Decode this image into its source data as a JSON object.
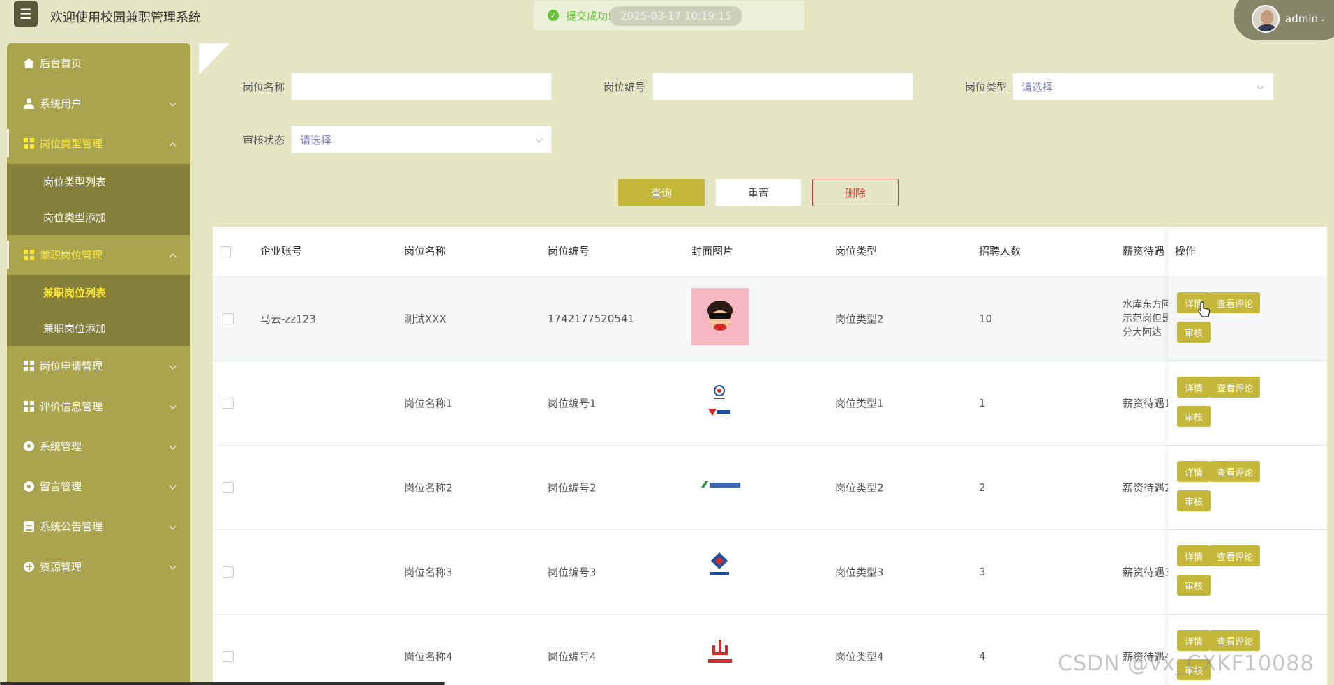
{
  "header": {
    "title": "欢迎使用校园兼职管理系统",
    "toast_text": "提交成功!",
    "toast_time": "2025-03-17 10:19:15",
    "user_name": "admin"
  },
  "sidebar": {
    "items": [
      {
        "label": "后台首页",
        "icon": "home-icon"
      },
      {
        "label": "系统用户",
        "icon": "user-icon"
      },
      {
        "label": "岗位类型管理",
        "icon": "grid-icon",
        "sub": [
          "岗位类型列表",
          "岗位类型添加"
        ]
      },
      {
        "label": "兼职岗位管理",
        "icon": "grid-icon",
        "sub": [
          "兼职岗位列表",
          "兼职岗位添加"
        ]
      },
      {
        "label": "岗位申请管理",
        "icon": "grid-icon"
      },
      {
        "label": "评价信息管理",
        "icon": "grid-icon"
      },
      {
        "label": "系统管理",
        "icon": "gear-icon"
      },
      {
        "label": "留言管理",
        "icon": "gear-icon"
      },
      {
        "label": "系统公告管理",
        "icon": "doc-icon"
      },
      {
        "label": "资源管理",
        "icon": "plus-circle-icon"
      }
    ]
  },
  "search": {
    "name_label": "岗位名称",
    "code_label": "岗位编号",
    "type_label": "岗位类型",
    "type_placeholder": "请选择",
    "status_label": "审核状态",
    "status_placeholder": "请选择",
    "query_btn": "查询",
    "reset_btn": "重置",
    "delete_btn": "删除"
  },
  "table": {
    "headers": [
      "企业账号",
      "岗位名称",
      "岗位编号",
      "封面图片",
      "岗位类型",
      "招聘人数",
      "薪资待遇",
      "操作"
    ],
    "rows": [
      {
        "account": "马云-zz123",
        "name": "测试XXX",
        "code": "1742177520541",
        "type": "岗位类型2",
        "count": "10",
        "salary": [
          "水库东方阿",
          "示范岗但是",
          "分大阿达"
        ]
      },
      {
        "account": "",
        "name": "岗位名称1",
        "code": "岗位编号1",
        "type": "岗位类型1",
        "count": "1",
        "salary": [
          "薪资待遇1"
        ]
      },
      {
        "account": "",
        "name": "岗位名称2",
        "code": "岗位编号2",
        "type": "岗位类型2",
        "count": "2",
        "salary": [
          "薪资待遇2"
        ]
      },
      {
        "account": "",
        "name": "岗位名称3",
        "code": "岗位编号3",
        "type": "岗位类型3",
        "count": "3",
        "salary": [
          "薪资待遇3"
        ]
      },
      {
        "account": "",
        "name": "岗位名称4",
        "code": "岗位编号4",
        "type": "岗位类型4",
        "count": "4",
        "salary": [
          "薪资待遇4"
        ]
      }
    ],
    "op_detail": "详情",
    "op_review": "查看评论",
    "op_audit": "审核"
  },
  "watermark": "CSDN @vx_CXKF10088"
}
